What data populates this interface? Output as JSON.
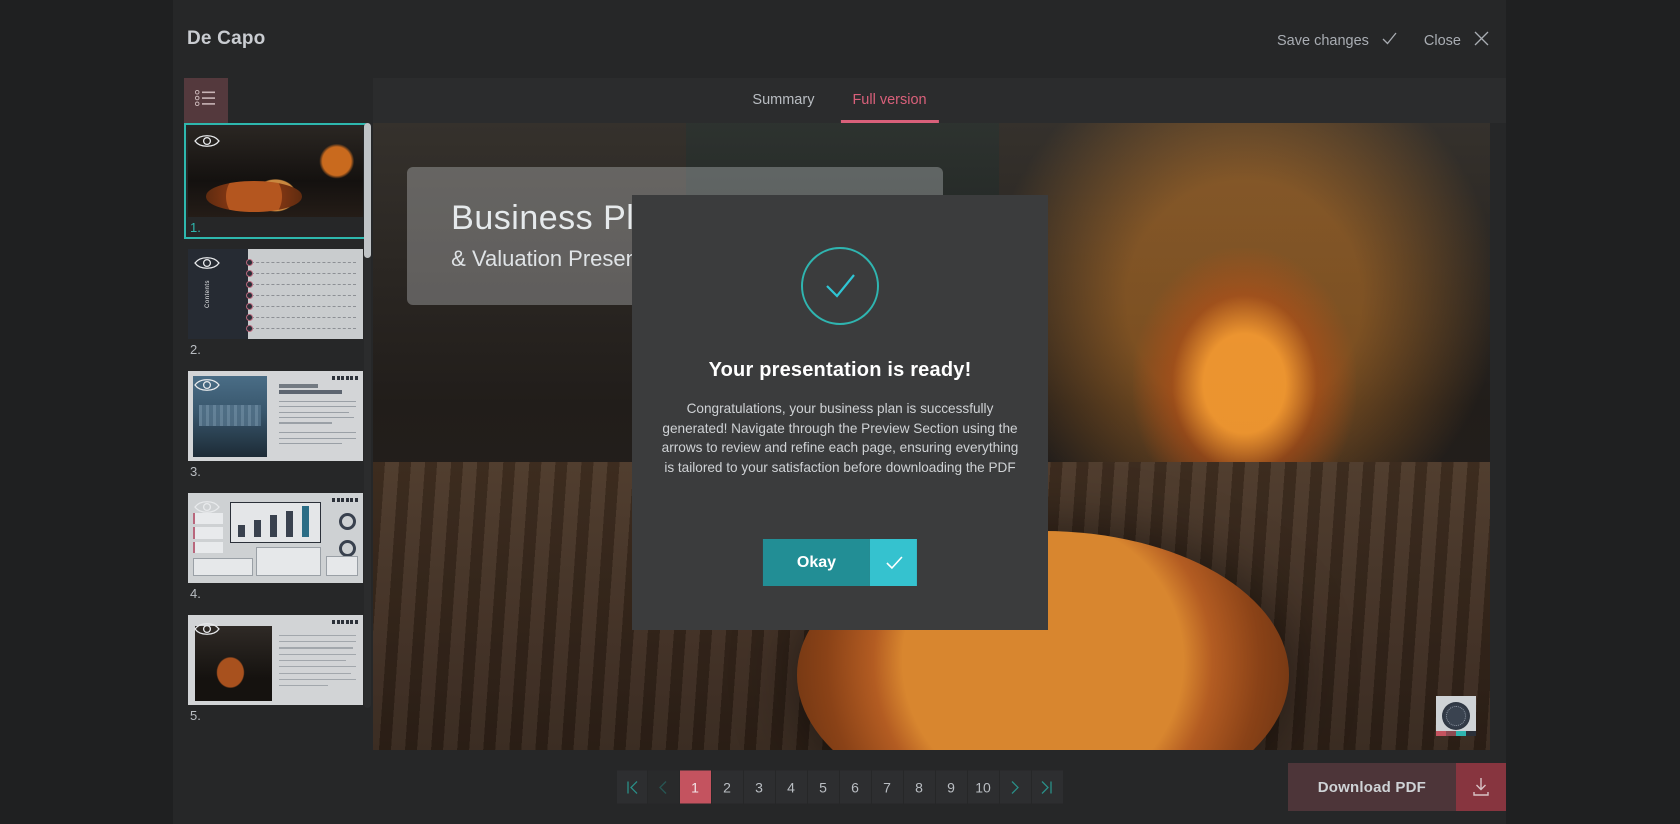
{
  "app": {
    "brand": "De Capo",
    "accent_red": "#d9607a",
    "accent_teal": "#2eb8ae",
    "bg": "#262728"
  },
  "topbar": {
    "save_label": "Save changes",
    "close_label": "Close"
  },
  "tabs": [
    {
      "label": "Summary",
      "active": false
    },
    {
      "label": "Full version",
      "active": true
    }
  ],
  "sidebar": {
    "menu_icon": "list-icon",
    "eye_icon": "eye-icon",
    "thumbnails": [
      {
        "number": "1.",
        "selected": true,
        "kind": "pizza",
        "caption": ""
      },
      {
        "number": "2.",
        "selected": false,
        "kind": "contents",
        "caption": "Contents"
      },
      {
        "number": "3.",
        "selected": false,
        "kind": "city",
        "caption": "OUR VISION&MISSION"
      },
      {
        "number": "4.",
        "selected": false,
        "kind": "dashboard",
        "caption": ""
      },
      {
        "number": "5.",
        "selected": false,
        "kind": "document",
        "caption": ""
      }
    ]
  },
  "preview": {
    "slide_title": "Business Plan",
    "slide_subtitle": "& Valuation Presentation",
    "logo_name": "brand-disc-logo"
  },
  "pagination": {
    "first_label": "first-page",
    "prev_label": "previous-page",
    "next_label": "next-page",
    "last_label": "last-page",
    "pages": [
      "1",
      "2",
      "3",
      "4",
      "5",
      "6",
      "7",
      "8",
      "9",
      "10"
    ],
    "current": "1"
  },
  "download": {
    "label": "Download PDF",
    "icon": "download-icon"
  },
  "modal": {
    "icon": "check-circle-icon",
    "title": "Your presentation is ready!",
    "body": "Congratulations, your business plan is successfully generated!\nNavigate through the Preview Section using the arrows to review and refine each page, ensuring everything is tailored to your satisfaction before downloading the PDF",
    "ok_label": "Okay",
    "ok_icon": "check-icon"
  }
}
